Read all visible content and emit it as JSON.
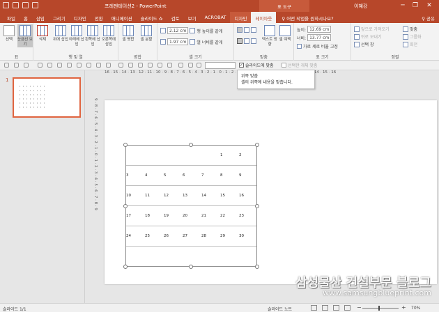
{
  "titlebar": {
    "title": "프레젠테이션2 - PowerPoint",
    "context_group": "표 도구",
    "user": "이혜강",
    "minimize": "─",
    "restore": "❐",
    "close": "✕"
  },
  "tabs": [
    "파일",
    "홈",
    "삽입",
    "그리기",
    "디자인",
    "전환",
    "애니메이션",
    "슬라이드 쇼",
    "검토",
    "보기",
    "ACROBAT"
  ],
  "context_tabs": [
    "디자인",
    "레이아웃"
  ],
  "tell_me": "어떤 작업을 원하시나요?",
  "share": "공유",
  "ribbon": {
    "select_label": "선택",
    "gridlines_label": "눈금선 보기",
    "table_group": "표",
    "delete_label": "삭제",
    "insert_above": "위에 삽입",
    "insert_below": "아래에 삽입",
    "insert_left": "왼쪽에 삽입",
    "insert_right": "오른쪽에 삽입",
    "rows_cols_group": "행 및 열",
    "merge_cells": "셀 병합",
    "split_cells": "셀 분할",
    "merge_group": "병합",
    "row_height": "2.12 cm",
    "col_width": "1.97 cm",
    "distribute_rows": "행 높이를 같게",
    "distribute_cols": "열 너비를 같게",
    "cell_size_group": "셀 크기",
    "text_direction": "텍스트 방향",
    "cell_margins": "셀 여백",
    "alignment_group": "맞춤",
    "table_height_label": "높이:",
    "table_height": "12.69 cm",
    "table_width_label": "너비:",
    "table_width": "13.77 cm",
    "lock_aspect": "가로 세로 비율 고정",
    "table_size_group": "표 크기",
    "bring_forward": "앞으로 가져오기",
    "send_backward": "뒤로 보내기",
    "selection_pane": "선택 창",
    "align": "맞춤",
    "group": "그룹화",
    "rotate": "회전",
    "arrange_group": "정렬"
  },
  "toolrow": {
    "snap_to_slide": "슬라이드에 맞춤",
    "snap_to_selection": "선택한 개체 맞춤"
  },
  "tooltip": {
    "title": "위쪽 맞춤",
    "body": "셀의 위쪽에 내용을 맞춥니다."
  },
  "rulers": {
    "horizontal": "16 · 15 · 14 · 13 · 12 · 11 · 10 · 9 · 8 · 7 · 6 · 5 · 4 · 3 · 2 · 1 · 0 · 1 · 2 · 3 · 4 · 5 · 6 · 7 · 8 · 9 · 10 · 11 · 12 · 13 · 14 · 15 · 16",
    "vertical": "9 · 8 · 7 · 6 · 5 · 4 · 3 · 2 · 1 · 0 · 1 · 2 · 3 · 4 · 5 · 6 · 7 · 8 · 9"
  },
  "thumbnail": {
    "number": "1"
  },
  "calendar": {
    "rows": [
      [
        "",
        "",
        "",
        "",
        "",
        "1",
        "2"
      ],
      [
        "3",
        "4",
        "5",
        "6",
        "7",
        "8",
        "9"
      ],
      [
        "10",
        "11",
        "12",
        "13",
        "14",
        "15",
        "16"
      ],
      [
        "17",
        "18",
        "19",
        "20",
        "21",
        "22",
        "23"
      ],
      [
        "24",
        "25",
        "26",
        "27",
        "28",
        "29",
        "30"
      ],
      [
        "",
        "",
        "",
        "",
        "",
        "",
        ""
      ]
    ]
  },
  "watermark": {
    "line1": "삼성물산 건설부문 블로그",
    "line2": "www.samsungblueprint.com"
  },
  "statusbar": {
    "slide_count": "슬라이드 1/1",
    "notes": "슬라이드 노트",
    "zoom_out": "−",
    "zoom_in": "+",
    "zoom": "70%",
    "zoom_fraction": 0.7
  },
  "colors": {
    "brand": "#b7472a",
    "context_tab": "#c75a3b",
    "selection_border": "#e0643f"
  }
}
